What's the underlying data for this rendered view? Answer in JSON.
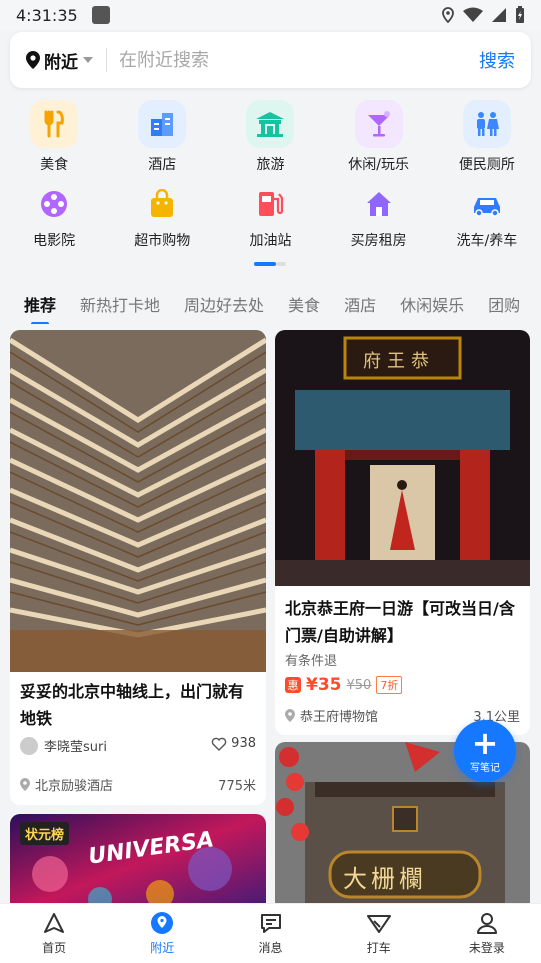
{
  "status": {
    "time": "4:31:35"
  },
  "search": {
    "location_label": "附近",
    "placeholder": "在附近搜索",
    "button_label": "搜索"
  },
  "categories": [
    {
      "label": "美食",
      "icon": "food-icon",
      "bg": "#fff1d6",
      "color": "#f5a300"
    },
    {
      "label": "酒店",
      "icon": "hotel-icon",
      "bg": "#e3efff",
      "color": "#2f7dff"
    },
    {
      "label": "旅游",
      "icon": "travel-icon",
      "bg": "#ddf7f0",
      "color": "#17c2a0"
    },
    {
      "label": "休闲/玩乐",
      "icon": "cocktail-icon",
      "bg": "#f3e6ff",
      "color": "#b066ff"
    },
    {
      "label": "便民厕所",
      "icon": "toilet-icon",
      "bg": "#e3efff",
      "color": "#3c86ff"
    },
    {
      "label": "电影院",
      "icon": "film-icon",
      "bg": "",
      "color": "#b066ff"
    },
    {
      "label": "超市购物",
      "icon": "shopping-bag-icon",
      "bg": "",
      "color": "#f5b400"
    },
    {
      "label": "加油站",
      "icon": "fuel-icon",
      "bg": "",
      "color": "#ff4d5a"
    },
    {
      "label": "买房租房",
      "icon": "house-icon",
      "bg": "",
      "color": "#8f66ff"
    },
    {
      "label": "洗车/养车",
      "icon": "car-icon",
      "bg": "",
      "color": "#2f7dff"
    }
  ],
  "tabs": [
    "推荐",
    "新热打卡地",
    "周边好去处",
    "美食",
    "酒店",
    "休闲娱乐",
    "团购"
  ],
  "cards": {
    "left1": {
      "title": "妥妥的北京中轴线上，出门就有地铁",
      "author": "李晓莹suri",
      "likes": "938",
      "place": "北京励骏酒店",
      "distance": "775米"
    },
    "left2": {
      "tag": "状元榜",
      "sign": "UNIVERSA"
    },
    "right1": {
      "plaque": "府王恭",
      "title": "北京恭王府一日游【可改当日/含门票/自助讲解】",
      "condition": "有条件退",
      "hui": "惠",
      "price": "¥35",
      "orig_price": "¥50",
      "discount": "7折",
      "place": "恭王府博物馆",
      "distance": "3.1公里"
    },
    "right2": {
      "sign": "大栅欄"
    }
  },
  "fab": {
    "label": "写笔记"
  },
  "nav": [
    {
      "label": "首页",
      "icon": "home-nav-icon"
    },
    {
      "label": "附近",
      "icon": "nearby-nav-icon"
    },
    {
      "label": "消息",
      "icon": "message-nav-icon"
    },
    {
      "label": "打车",
      "icon": "taxi-nav-icon"
    },
    {
      "label": "未登录",
      "icon": "profile-nav-icon"
    }
  ],
  "colors": {
    "accent": "#1677ff",
    "price": "#ff4a2d"
  }
}
